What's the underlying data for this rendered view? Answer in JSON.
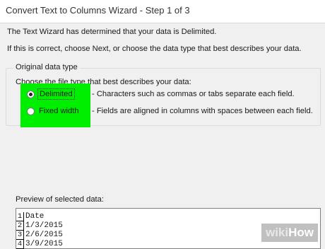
{
  "window": {
    "title": "Convert Text to Columns Wizard - Step 1 of 3"
  },
  "intro": {
    "line1": "The Text Wizard has determined that your data is Delimited.",
    "line2": "If this is correct, choose Next, or choose the data type that best describes your data."
  },
  "original_data_type": {
    "legend": "Original data type",
    "prompt": "Choose the file type that best describes your data:",
    "options": [
      {
        "label": "Delimited",
        "selected": true,
        "hint": "- Characters such as commas or tabs separate each field."
      },
      {
        "label": "Fixed width",
        "selected": false,
        "hint": "- Fields are aligned in columns with spaces between each field."
      }
    ],
    "highlight_color": "#00ee00"
  },
  "preview": {
    "label": "Preview of selected data:",
    "rows": [
      {
        "num": "1",
        "text": "Date"
      },
      {
        "num": "2",
        "text": "1/3/2015"
      },
      {
        "num": "3",
        "text": "2/6/2015"
      },
      {
        "num": "4",
        "text": "3/9/2015"
      }
    ]
  },
  "watermark": {
    "part1": "wiki",
    "part2": "How"
  }
}
